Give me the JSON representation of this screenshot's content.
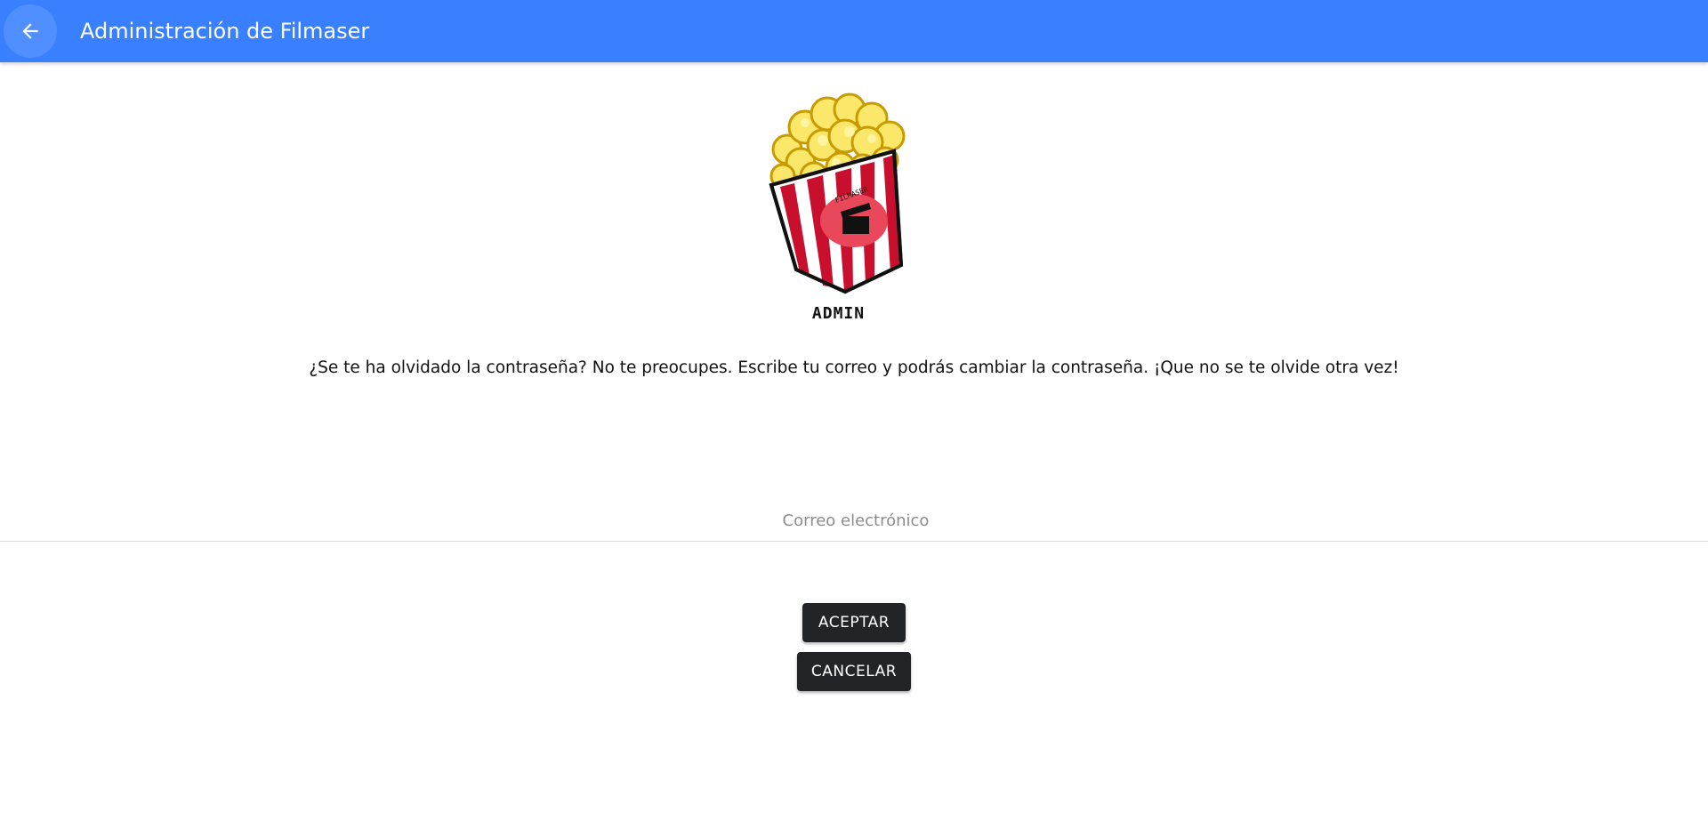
{
  "header": {
    "title": "Administración de Filmaser",
    "back_icon": "arrow-back-icon",
    "color": "#3880ff"
  },
  "logo": {
    "caption": "ADMIN",
    "badge_text": "FILMASER",
    "icon": "popcorn-icon"
  },
  "main": {
    "message": "¿Se te ha olvidado la contraseña? No te preocupes. Escribe tu correo y podrás cambiar la contraseña. ¡Que no se te olvide otra vez!",
    "email_placeholder": "Correo electrónico",
    "email_value": ""
  },
  "buttons": {
    "accept_label": "ACEPTAR",
    "cancel_label": "CANCELAR",
    "color": "#222428"
  }
}
